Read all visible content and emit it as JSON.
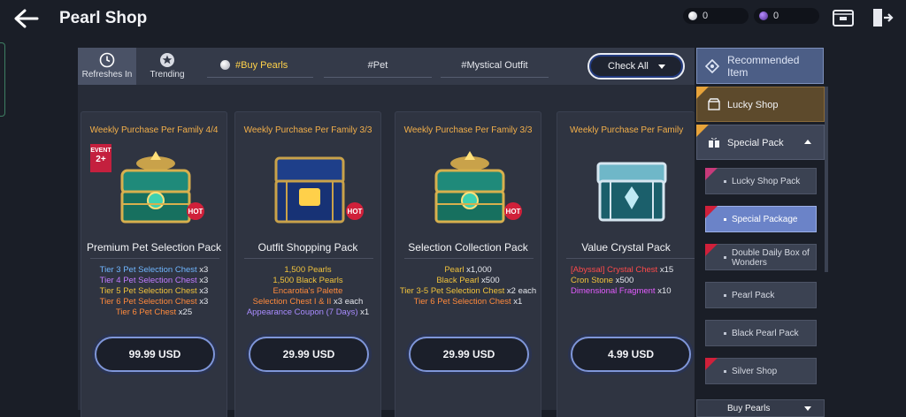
{
  "header": {
    "title": "Pearl Shop",
    "pearls": "0",
    "crystals": "0"
  },
  "tabs": {
    "refresh_label": "Refreshes In",
    "trending_label": "Trending",
    "categories": [
      "#Buy Pearls",
      "#Pet",
      "#Mystical Outfit"
    ],
    "check_all": "Check All"
  },
  "cards": [
    {
      "limit": "Weekly Purchase Per Family 4/4",
      "name": "Premium Pet Selection Pack",
      "event_badge_top": "EVENT",
      "event_badge_main": "2+",
      "hot": "HOT",
      "items": [
        {
          "text": "Tier 3 Pet Selection Chest",
          "qty": " x3",
          "color": "#6fb6ff"
        },
        {
          "text": "Tier 4 Pet Selection Chest",
          "qty": " x3",
          "color": "#c17cff"
        },
        {
          "text": "Tier 5 Pet Selection Chest",
          "qty": " x3",
          "color": "#f0c23c"
        },
        {
          "text": "Tier 6 Pet Selection Chest",
          "qty": " x3",
          "color": "#ff8a3c"
        },
        {
          "text": "Tier 6 Pet Chest",
          "qty": " x25",
          "color": "#ff8a3c"
        }
      ],
      "price": "99.99 USD"
    },
    {
      "limit": "Weekly Purchase Per Family 3/3",
      "name": "Outfit Shopping Pack",
      "hot": "HOT",
      "items": [
        {
          "text": "1,500 Pearls",
          "qty": "",
          "color": "#f0c23c"
        },
        {
          "text": "1,500 Black Pearls",
          "qty": "",
          "color": "#f0c23c"
        },
        {
          "text": "Encarotia's Palette",
          "qty": "",
          "color": "#ff8a3c"
        },
        {
          "text": "Selection Chest I & II",
          "qty": " x3 each",
          "color": "#ff8a3c"
        },
        {
          "text": "Appearance Coupon (7 Days)",
          "qty": " x1",
          "color": "#a98cff"
        }
      ],
      "price": "29.99 USD"
    },
    {
      "limit": "Weekly Purchase Per Family 3/3",
      "name": "Selection Collection Pack",
      "hot": "HOT",
      "items": [
        {
          "text": "Pearl",
          "qty": " x1,000",
          "color": "#f0c23c"
        },
        {
          "text": "Black Pearl",
          "qty": " x500",
          "color": "#f0c23c"
        },
        {
          "text": "Tier 3-5 Pet Selection Chest",
          "qty": " x2 each",
          "color": "#f0c23c"
        },
        {
          "text": "Tier 6 Pet Selection Chest",
          "qty": " x1",
          "color": "#ff8a3c"
        }
      ],
      "price": "29.99 USD"
    },
    {
      "limit": "Weekly Purchase Per Family",
      "name": "Value Crystal Pack",
      "items": [
        {
          "text": "[Abyssal] Crystal Chest",
          "qty": " x15",
          "color": "#ff4a4a"
        },
        {
          "text": "Cron Stone",
          "qty": " x500",
          "color": "#f0c23c"
        },
        {
          "text": "Dimensional Fragment",
          "qty": " x10",
          "color": "#e45cff"
        }
      ],
      "price": "4.99 USD"
    }
  ],
  "sidebar": {
    "recommended": "Recommended Item",
    "lucky_shop": "Lucky Shop",
    "special_pack": "Special Pack",
    "sub_items": [
      "Lucky Shop Pack",
      "Special Package",
      "Double Daily Box of Wonders",
      "Pearl Pack",
      "Black Pearl Pack",
      "Silver Shop"
    ],
    "buy_pearls": "Buy Pearls"
  },
  "colors": {
    "accent_gold": "#ffd24a",
    "limit_orange": "#f4b04a",
    "active_blue": "#6b83c8"
  }
}
